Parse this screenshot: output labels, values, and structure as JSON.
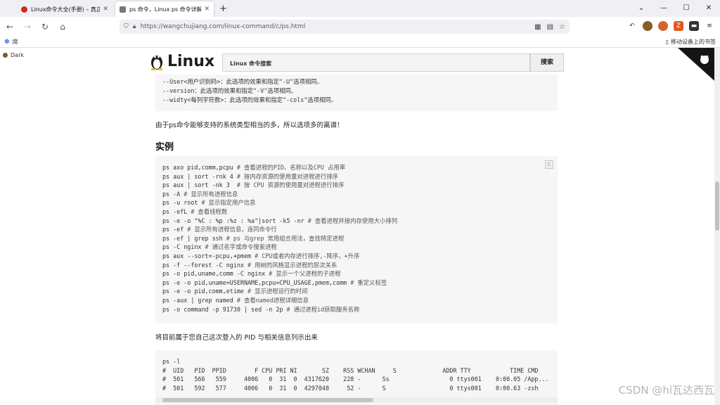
{
  "browser": {
    "tabs": [
      {
        "title": "Linux命令大全(手册) – 真正好用",
        "active": false
      },
      {
        "title": "ps 命令，Linux ps 命令详解：",
        "active": true
      }
    ],
    "url": "https://wangchujiang.com/linux-command/c/ps.html",
    "bookmarks_left": "席",
    "bookmarks_right": "移动设备上的书签"
  },
  "page": {
    "dark_label": "Dark",
    "logo_text": "Linux",
    "search_placeholder": "Linux 命令搜索",
    "search_button": "搜索",
    "options_lines": [
      "--User<用户识别码>：此选项的效果和指定\"-U\"选项相同。",
      "--version：此选项的效果和指定\"-V\"选项相同。",
      "--widty<每列字符数>：此选项的效果和指定\"-cols\"选项相同。"
    ],
    "note": "由于ps命令能够支持的系统类型相当的多，所以选项多的离谱！",
    "examples_heading": "实例",
    "copy_label": "C",
    "examples": [
      "ps axo pid,comm,pcpu # 查看进程的PID、名称以及CPU 占用率",
      "ps aux | sort -rnk 4 # 按内存资源的使用量对进程进行排序",
      "ps aux | sort -nk 3  # 按 CPU 资源的使用量对进程进行排序",
      "ps -A # 显示所有进程信息",
      "ps -u root # 显示指定用户信息",
      "ps -efL # 查看线程数",
      "ps -e -o \"%C : %p :%z : %a\"|sort -k5 -nr # 查看进程并按内存使用大小排列",
      "ps -ef # 显示所有进程信息，连同命令行",
      "ps -ef | grep ssh # ps 与grep 常用组合用法，查找特定进程",
      "ps -C nginx # 通过名字或命令搜索进程",
      "ps aux --sort=-pcpu,+pmem # CPU或者内存进行排序,-降序，+升序",
      "ps -f --forest -C nginx # 用树的风格显示进程的层次关系",
      "ps -o pid,uname,comm -C nginx # 显示一个父进程的子进程",
      "ps -e -o pid,uname=USERNAME,pcpu=CPU_USAGE,pmem,comm # 重定义标签",
      "ps -e -o pid,comm,etime # 显示进程运行的时间",
      "ps -aux | grep named # 查看named进程详细信息",
      "ps -o command -p 91730 | sed -n 2p # 通过进程id获取服务名称"
    ],
    "pid_note": "将目前属于您自己这次登入的 PID 与相关信息列示出来",
    "output_lines": [
      "ps -l",
      "#  UID   PID  PPID        F CPU PRI NI       SZ    RSS WCHAN     S             ADDR TTY           TIME CMD",
      "#  501   566   559     4006   0  31  0  4317620    228 -      Ss                 0 ttys001    0:00.05 /App...",
      "#  501   592   577     4006   0  31  0  4297048     52 -      S                  0 ttys001    0:00.63 -zsh"
    ],
    "watermark": "CSDN @hl瓦达西瓦"
  }
}
